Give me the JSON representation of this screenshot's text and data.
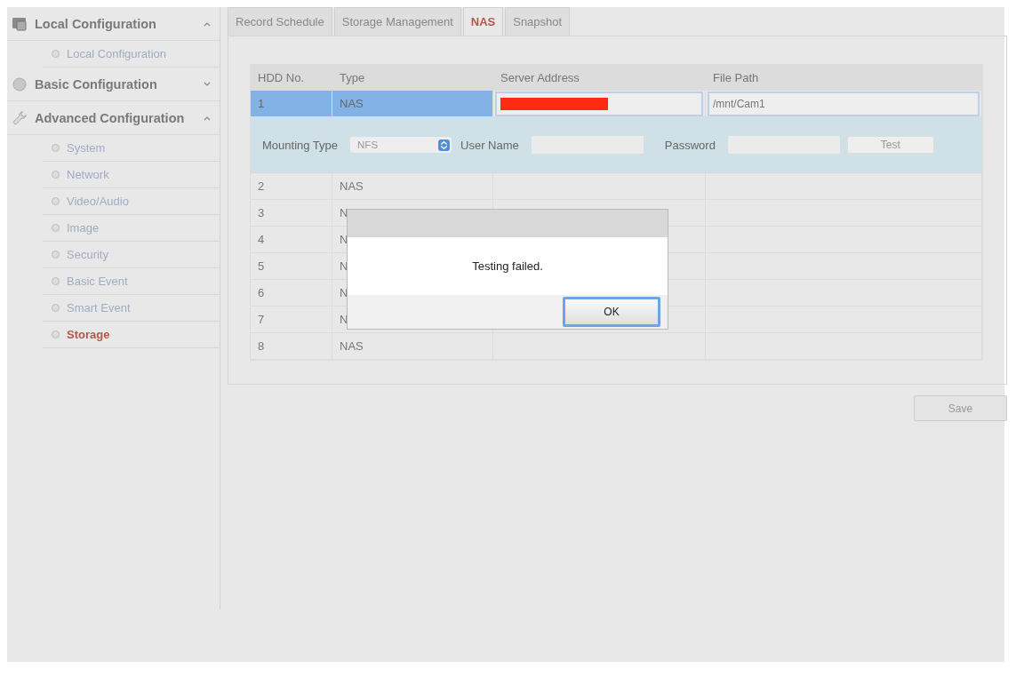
{
  "sidebar": {
    "sections": [
      {
        "kind": "local",
        "title": "Local Configuration",
        "expanded": true,
        "items": [
          {
            "label": "Local Configuration",
            "selected": false
          }
        ]
      },
      {
        "kind": "basic",
        "title": "Basic Configuration",
        "expanded": false
      },
      {
        "kind": "advanced",
        "title": "Advanced Configuration",
        "expanded": true,
        "items": [
          {
            "label": "System",
            "selected": false
          },
          {
            "label": "Network",
            "selected": false
          },
          {
            "label": "Video/Audio",
            "selected": false
          },
          {
            "label": "Image",
            "selected": false
          },
          {
            "label": "Security",
            "selected": false
          },
          {
            "label": "Basic Event",
            "selected": false
          },
          {
            "label": "Smart Event",
            "selected": false
          },
          {
            "label": "Storage",
            "selected": true
          }
        ]
      }
    ]
  },
  "tabs": [
    {
      "label": "Record Schedule",
      "selected": false
    },
    {
      "label": "Storage Management",
      "selected": false
    },
    {
      "label": "NAS",
      "selected": true
    },
    {
      "label": "Snapshot",
      "selected": false
    }
  ],
  "table": {
    "columns": [
      "HDD No.",
      "Type",
      "Server Address",
      "File Path"
    ],
    "rows": [
      {
        "hdd": "1",
        "type": "NAS",
        "file_path": "/mnt/Cam1",
        "selected": true,
        "expanded": true
      },
      {
        "hdd": "2",
        "type": "NAS",
        "selected": false,
        "expanded": false
      },
      {
        "hdd": "3",
        "type": "N",
        "selected": false,
        "expanded": false
      },
      {
        "hdd": "4",
        "type": "N",
        "selected": false,
        "expanded": false
      },
      {
        "hdd": "5",
        "type": "N",
        "selected": false,
        "expanded": false
      },
      {
        "hdd": "6",
        "type": "N",
        "selected": false,
        "expanded": false
      },
      {
        "hdd": "7",
        "type": "N",
        "selected": false,
        "expanded": false
      },
      {
        "hdd": "8",
        "type": "NAS",
        "selected": false,
        "expanded": false
      }
    ]
  },
  "mount": {
    "mounting_type_label": "Mounting Type",
    "mounting_type": "NFS",
    "user_name_label": "User Name",
    "password_label": "Password",
    "test_button": "Test"
  },
  "dialog": {
    "message": "Testing failed.",
    "ok_button": "OK"
  },
  "save_button": "Save"
}
